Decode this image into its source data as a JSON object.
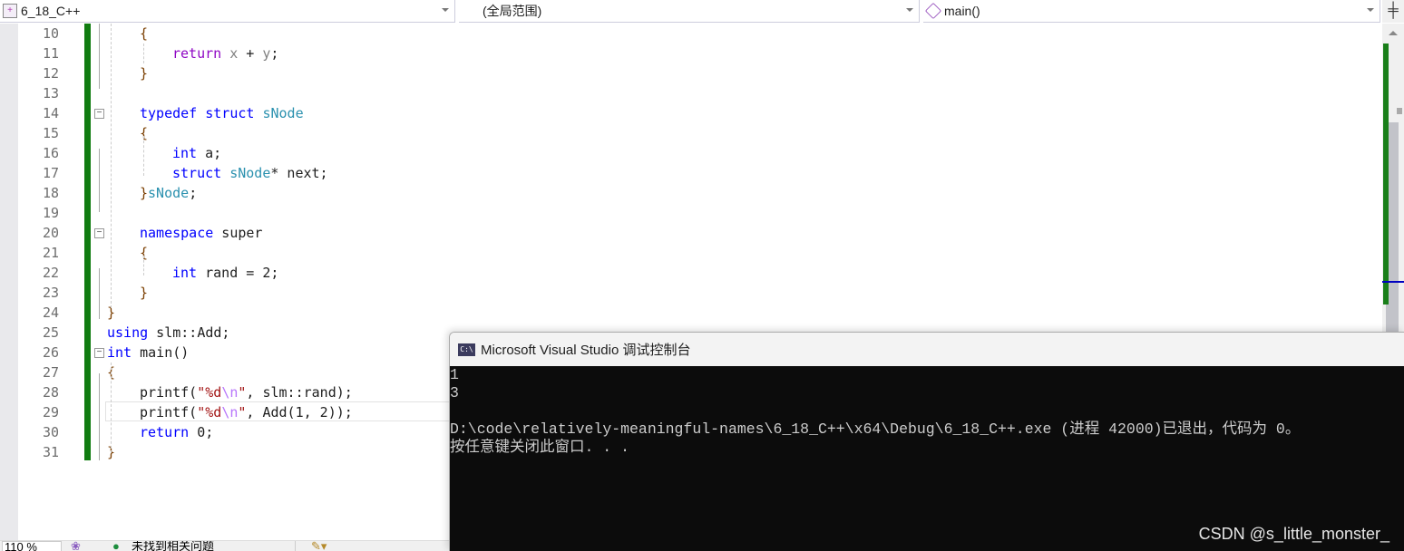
{
  "navbar": {
    "project": "6_18_C++",
    "scope": "(全局范围)",
    "member": "main()",
    "split_icon": "splitter-icon"
  },
  "editor": {
    "lines": [
      {
        "n": "10",
        "indent": 1,
        "tokens": [
          [
            "{",
            "br"
          ]
        ]
      },
      {
        "n": "11",
        "indent": 2,
        "tokens": [
          [
            "return",
            "ret"
          ],
          [
            " ",
            ""
          ],
          [
            "x",
            "pm"
          ],
          [
            " + ",
            ""
          ],
          [
            "y",
            "pm"
          ],
          [
            ";",
            ""
          ]
        ]
      },
      {
        "n": "12",
        "indent": 1,
        "tokens": [
          [
            "}",
            "br"
          ]
        ]
      },
      {
        "n": "13",
        "indent": 0,
        "tokens": []
      },
      {
        "n": "14",
        "indent": 1,
        "tokens": [
          [
            "typedef",
            "kw"
          ],
          [
            " ",
            ""
          ],
          [
            "struct",
            "kw"
          ],
          [
            " ",
            ""
          ],
          [
            "sNode",
            "ty"
          ]
        ]
      },
      {
        "n": "15",
        "indent": 1,
        "tokens": [
          [
            "{",
            "br"
          ]
        ]
      },
      {
        "n": "16",
        "indent": 2,
        "tokens": [
          [
            "int",
            "kw"
          ],
          [
            " a;",
            ""
          ]
        ]
      },
      {
        "n": "17",
        "indent": 2,
        "tokens": [
          [
            "struct",
            "kw"
          ],
          [
            " ",
            ""
          ],
          [
            "sNode",
            "ty"
          ],
          [
            "* next;",
            ""
          ]
        ]
      },
      {
        "n": "18",
        "indent": 1,
        "tokens": [
          [
            "}",
            "br"
          ],
          [
            "sNode",
            "ty"
          ],
          [
            ";",
            ""
          ]
        ]
      },
      {
        "n": "19",
        "indent": 0,
        "tokens": []
      },
      {
        "n": "20",
        "indent": 1,
        "tokens": [
          [
            "namespace",
            "kw"
          ],
          [
            " super",
            ""
          ]
        ]
      },
      {
        "n": "21",
        "indent": 1,
        "tokens": [
          [
            "{",
            "br"
          ]
        ]
      },
      {
        "n": "22",
        "indent": 2,
        "tokens": [
          [
            "int",
            "kw"
          ],
          [
            " rand = 2;",
            ""
          ]
        ]
      },
      {
        "n": "23",
        "indent": 1,
        "tokens": [
          [
            "}",
            "br"
          ]
        ]
      },
      {
        "n": "24",
        "indent": 0,
        "tokens": [
          [
            "}",
            "br"
          ]
        ]
      },
      {
        "n": "25",
        "indent": 0,
        "tokens": [
          [
            "using",
            "kw"
          ],
          [
            " slm::Add;",
            ""
          ]
        ]
      },
      {
        "n": "26",
        "indent": 0,
        "tokens": [
          [
            "int",
            "kw"
          ],
          [
            " main()",
            ""
          ]
        ]
      },
      {
        "n": "27",
        "indent": 0,
        "tokens": [
          [
            "{",
            "br"
          ]
        ]
      },
      {
        "n": "28",
        "indent": 1,
        "tokens": [
          [
            "printf(",
            ""
          ],
          [
            "\"%d",
            "str"
          ],
          [
            "\\n",
            "esc"
          ],
          [
            "\"",
            "str"
          ],
          [
            ", slm::rand);",
            ""
          ]
        ]
      },
      {
        "n": "29",
        "indent": 1,
        "tokens": [
          [
            "printf(",
            ""
          ],
          [
            "\"%d",
            "str"
          ],
          [
            "\\n",
            "esc"
          ],
          [
            "\"",
            "str"
          ],
          [
            ", Add(1, 2));",
            ""
          ]
        ]
      },
      {
        "n": "30",
        "indent": 1,
        "tokens": [
          [
            "return",
            "kw"
          ],
          [
            " 0;",
            ""
          ]
        ]
      },
      {
        "n": "31",
        "indent": 0,
        "tokens": [
          [
            "}",
            "br"
          ]
        ]
      }
    ],
    "colors": {
      "keyword": "#0000ff",
      "return": "#8f08c4",
      "type": "#2b91af",
      "string": "#a31515",
      "change_bar": "#107c10"
    }
  },
  "statusbar": {
    "zoom": "110 %",
    "issues": "未找到相关问题"
  },
  "console": {
    "title": "Microsoft Visual Studio 调试控制台",
    "icon_text": "C:\\",
    "output": [
      "1",
      "3",
      "",
      "D:\\code\\relatively-meaningful-names\\6_18_C++\\x64\\Debug\\6_18_C++.exe (进程 42000)已退出，代码为 0。",
      "按任意键关闭此窗口. . ."
    ]
  },
  "watermark": "CSDN @s_little_monster_"
}
